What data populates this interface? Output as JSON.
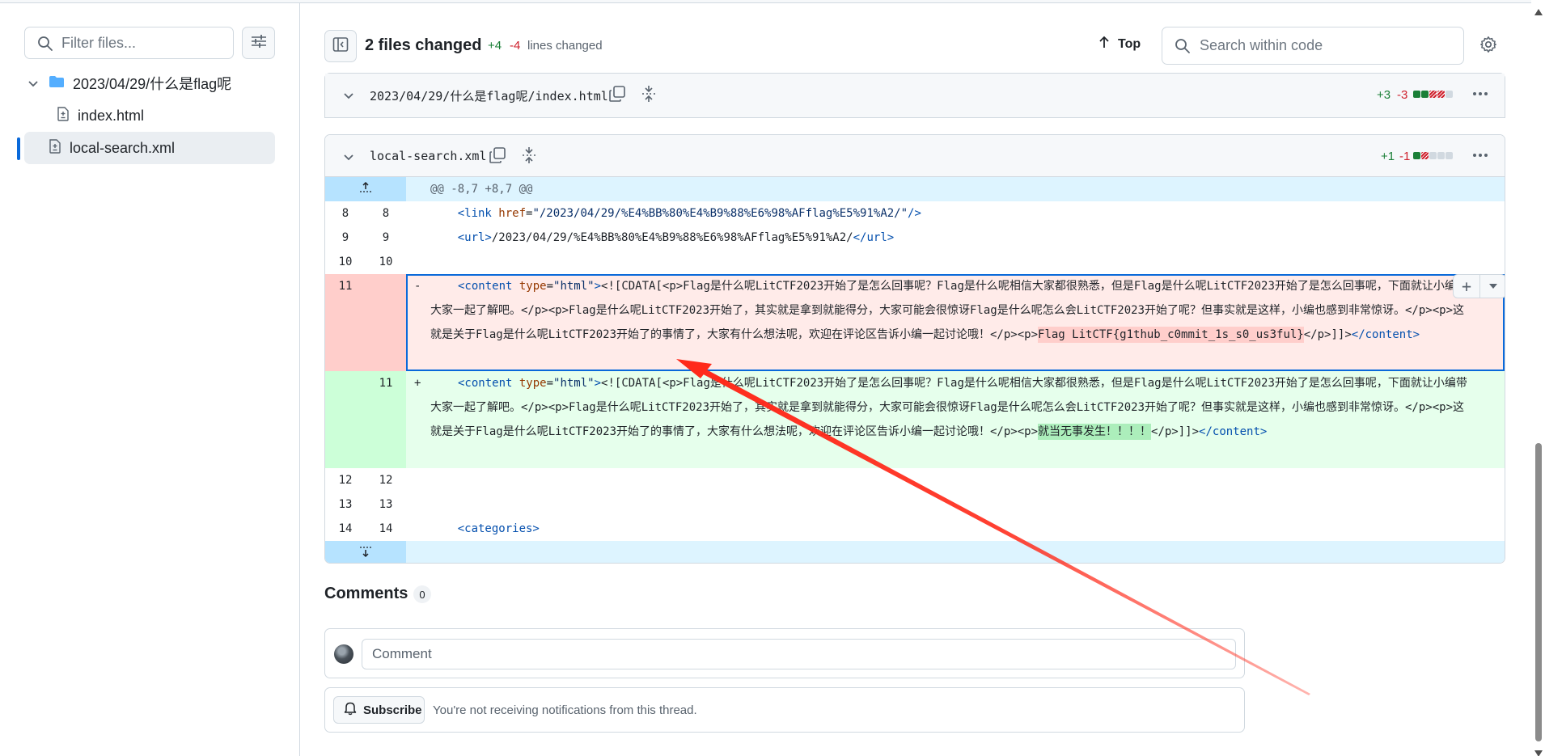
{
  "sidebar": {
    "filter_placeholder": "Filter files...",
    "folder": "2023/04/29/什么是flag呢",
    "files": [
      "index.html",
      "local-search.xml"
    ]
  },
  "header": {
    "title": "2 files changed",
    "additions": "+4",
    "deletions": "-4",
    "lines_changed": "lines changed",
    "top_label": "Top",
    "search_placeholder": "Search within code"
  },
  "file1": {
    "name": "2023/04/29/什么是flag呢/index.html",
    "additions": "+3",
    "deletions": "-3"
  },
  "file2": {
    "name": "local-search.xml",
    "additions": "+1",
    "deletions": "-1",
    "hunk": "@@ -8,7 +8,7 @@",
    "rows": [
      {
        "old": "8",
        "new": "8"
      },
      {
        "old": "9",
        "new": "9"
      },
      {
        "old": "10",
        "new": "10"
      }
    ],
    "line8": {
      "open": "<link ",
      "attr": "href",
      "eq": "=",
      "val": "\"/2023/04/29/%E4%BB%80%E4%B9%88%E6%98%AFflag%E5%91%A2/\"",
      "close": "/>"
    },
    "line9": {
      "open": "<url>",
      "body": "/2023/04/29/%E4%BB%80%E4%B9%88%E6%98%AFflag%E5%91%A2/",
      "close": "</url>"
    },
    "deleted": {
      "old": "11",
      "sign": "-",
      "tag_open": "<content ",
      "attr": "type",
      "eq": "=",
      "val": "\"html\"",
      "gt": ">",
      "text": "<![CDATA[<p>Flag是什么呢LitCTF2023开始了是怎么回事呢？Flag是什么呢相信大家都很熟悉，但是Flag是什么呢LitCTF2023开始了是怎么回事呢，下面就让小编带大家一起了解吧。</p><p>Flag是什么呢LitCTF2023开始了，其实就是拿到就能得分，大家可能会很惊讶Flag是什么呢怎么会LitCTF2023开始了呢？但事实就是这样，小编也感到非常惊讶。</p><p>这就是关于Flag是什么呢LitCTF2023开始了的事情了，大家有什么想法呢，欢迎在评论区告诉小编一起讨论哦！</p><p>",
      "highlight": "Flag LitCTF{g1thub_c0mmit_1s_s0_us3ful}",
      "tail": "</p>]]>",
      "tag_close": "</content>"
    },
    "added": {
      "new": "11",
      "sign": "+",
      "tag_open": "<content ",
      "attr": "type",
      "eq": "=",
      "val": "\"html\"",
      "gt": ">",
      "text": "<![CDATA[<p>Flag是什么呢LitCTF2023开始了是怎么回事呢？Flag是什么呢相信大家都很熟悉，但是Flag是什么呢LitCTF2023开始了是怎么回事呢，下面就让小编带大家一起了解吧。</p><p>Flag是什么呢LitCTF2023开始了，其实就是拿到就能得分，大家可能会很惊讶Flag是什么呢怎么会LitCTF2023开始了呢？但事实就是这样，小编也感到非常惊讶。</p><p>这就是关于Flag是什么呢LitCTF2023开始了的事情了，大家有什么想法呢，欢迎在评论区告诉小编一起讨论哦！</p><p>",
      "highlight": "就当无事发生！！！！",
      "tail": "</p>]]>",
      "tag_close": "</content>"
    },
    "rows_after": [
      {
        "old": "12",
        "new": "12"
      },
      {
        "old": "13",
        "new": "13"
      },
      {
        "old": "14",
        "new": "14"
      }
    ],
    "line14": "<categories>"
  },
  "comments": {
    "title": "Comments",
    "count": "0",
    "placeholder": "Comment",
    "subscribe": "Subscribe",
    "notice": "You're not receiving notifications from this thread."
  },
  "colors": {
    "accent": "#0969da",
    "addition": "#1a7f37",
    "deletion": "#cf222e",
    "annotation_arrow": "#ff2a1a"
  }
}
